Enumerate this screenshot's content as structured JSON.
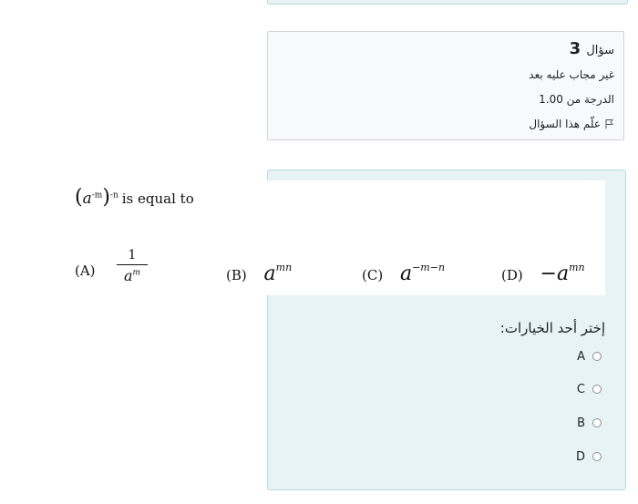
{
  "question": {
    "label": "سؤال",
    "number": "3",
    "status": "غير مجاب عليه بعد",
    "grade": "الدرجة من 1.00",
    "flag_label": "علّم هذا السؤال"
  },
  "problem": {
    "stem_text": "is equal to",
    "options": [
      {
        "letter": "(A)"
      },
      {
        "letter": "(B)",
        "base": "a",
        "exponent": "mn"
      },
      {
        "letter": "(C)",
        "base": "a",
        "exponent": "−m−n"
      },
      {
        "letter": "(D)",
        "base": "−a",
        "exponent": "mn"
      }
    ],
    "option_a": {
      "numerator": "1",
      "base": "a",
      "exponent": "m"
    },
    "stem_base": "a",
    "stem_inner_exp": "-m",
    "stem_outer_exp": "-n"
  },
  "answer": {
    "prompt": "إختر أحد الخيارات:",
    "choices": [
      "A",
      "C",
      "B",
      "D"
    ]
  },
  "colors": {
    "panel_bg": "#e7f3f5",
    "panel_border": "#b8dce2",
    "info_bg": "#f8f9fa"
  }
}
